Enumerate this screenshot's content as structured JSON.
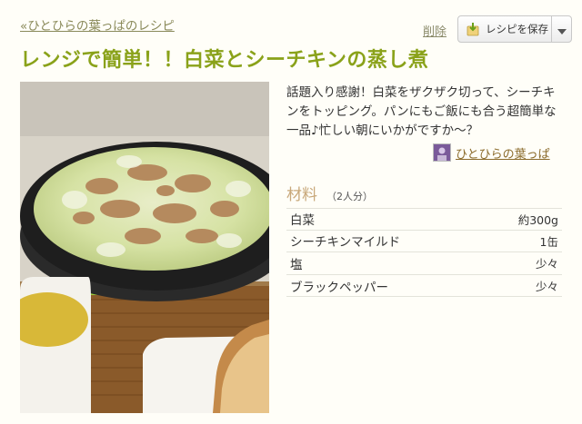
{
  "header": {
    "back_link": "«ひとひらの葉っぱのレシピ",
    "delete_label": "削除",
    "save_label": "レシピを保存"
  },
  "recipe": {
    "title": "レンジで簡単！！白菜とシーチキンの蒸し煮",
    "description": "話題入り感謝！白菜をザクザク切って、シーチキンをトッピング。パンにもご飯にも合う超簡単な一品♪忙しい朝にいかがですか〜？",
    "author": "ひとひらの葉っぱ",
    "ingredients_heading": "材料",
    "servings": "（2人分）",
    "ingredients": [
      {
        "name": "白菜",
        "qty": "約300g"
      },
      {
        "name": "シーチキンマイルド",
        "qty": "1缶"
      },
      {
        "name": "塩",
        "qty": "少々"
      },
      {
        "name": "ブラックペッパー",
        "qty": "少々"
      }
    ]
  },
  "colors": {
    "title": "#8aa21a",
    "link": "#8a8a5a",
    "heading": "#c8a87a"
  }
}
